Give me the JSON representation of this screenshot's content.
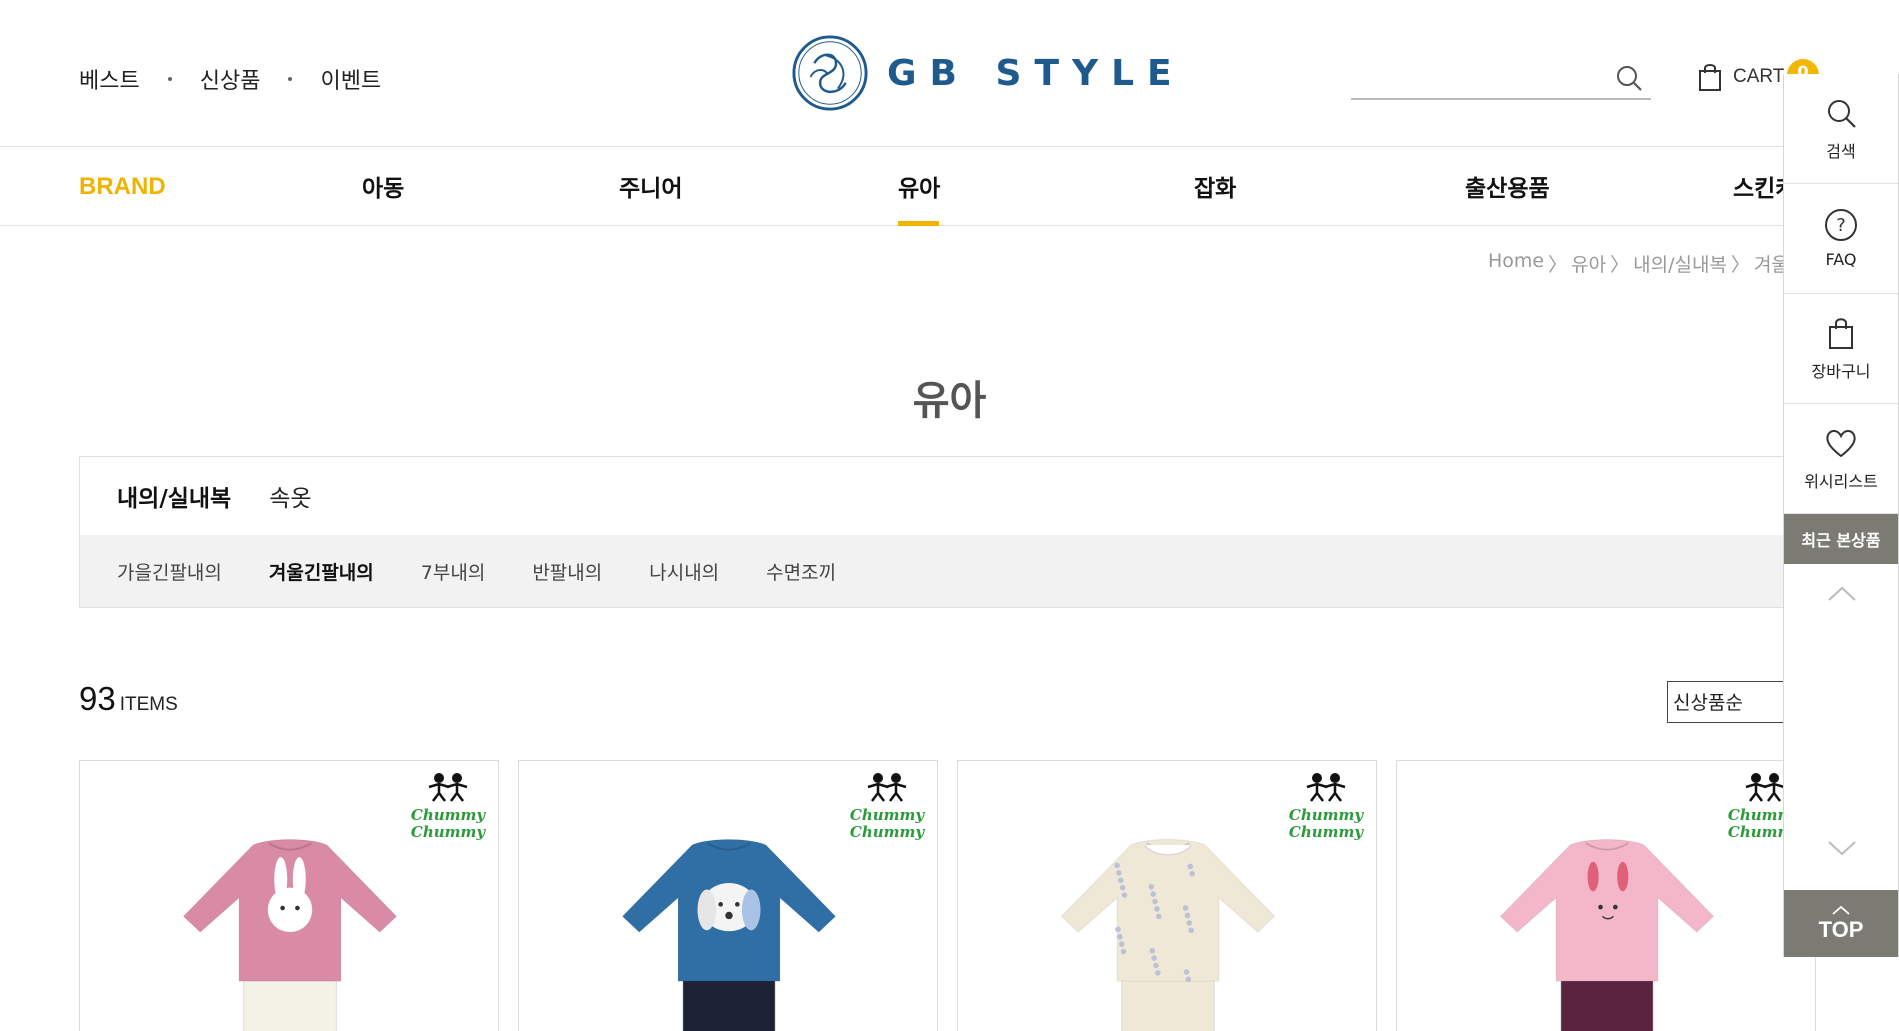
{
  "header": {
    "top_links": [
      "베스트",
      "신상품",
      "이벤트"
    ],
    "logo_text": "GB STYLE",
    "search_placeholder": "",
    "cart_label": "CART",
    "cart_count": "0"
  },
  "categories": {
    "brand": "BRAND",
    "items": [
      "아동",
      "주니어",
      "유아",
      "잡화",
      "출산용품",
      "스킨케"
    ],
    "active": "유아"
  },
  "breadcrumb": [
    "Home",
    "〉",
    "유아",
    "〉",
    "내의/실내복",
    "〉",
    "겨울긴팔"
  ],
  "page_title": "유아",
  "subcategory": {
    "current": "내의/실내복",
    "sibling": "속옷",
    "children": [
      "가을긴팔내의",
      "겨울긴팔내의",
      "7부내의",
      "반팔내의",
      "나시내의",
      "수면조끼"
    ],
    "selected_child": "겨울긴팔내의"
  },
  "listing": {
    "count": "93",
    "unit": "ITEMS",
    "sort_selected": "신상품순"
  },
  "products": [
    {
      "brand_line1": "Chummy",
      "brand_line2": "Chummy",
      "top_color": "#d98aa5",
      "bottom_color": "#f4f1e6",
      "motif": "rabbit"
    },
    {
      "brand_line1": "Chummy",
      "brand_line2": "Chummy",
      "top_color": "#2f6fa5",
      "bottom_color": "#1c2233",
      "motif": "puppy"
    },
    {
      "brand_line1": "Chummy",
      "brand_line2": "Chummy",
      "top_color": "#efe8d6",
      "bottom_color": "#efe8d6",
      "motif": "floral"
    },
    {
      "brand_line1": "Chummy",
      "brand_line2": "Chummy",
      "top_color": "#f3b7c9",
      "bottom_color": "#5a2440",
      "motif": "cat"
    }
  ],
  "quick_menu": {
    "items": [
      "검색",
      "FAQ",
      "장바구니",
      "위시리스트"
    ],
    "icons": [
      "search-icon",
      "question-icon",
      "shopping-bag-icon",
      "heart-icon"
    ],
    "recent": "최근 본상품",
    "top": "TOP"
  },
  "colors": {
    "accent": "#f0b400",
    "logo_blue": "#1f5a8e",
    "quick_gray": "#7b7b73"
  }
}
